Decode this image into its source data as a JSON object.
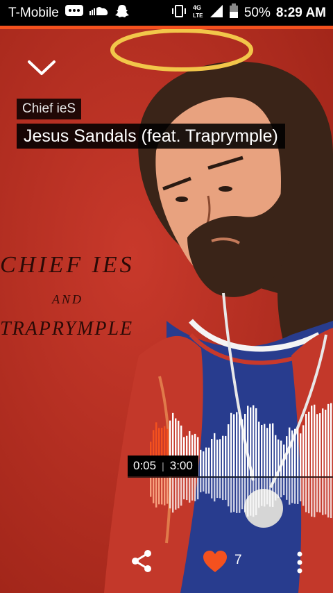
{
  "status_bar": {
    "carrier": "T-Mobile",
    "network": "4G LTE",
    "battery": "50%",
    "time": "8:29 AM",
    "icons": [
      "bbm-icon",
      "soundcloud-icon",
      "snapchat-icon",
      "vibrate-icon",
      "signal-icon",
      "battery-icon"
    ]
  },
  "player": {
    "artist": "Chief ieS",
    "title": "Jesus Sandals (feat. Traprymple)",
    "elapsed": "0:05",
    "duration": "3:00",
    "progress": 0.028,
    "likes": "7",
    "accent_color": "#f4511e"
  },
  "artwork": {
    "text_line1": "CHIEF IES",
    "text_line2": "AND",
    "text_line3": "TRAPRYMPLE"
  }
}
